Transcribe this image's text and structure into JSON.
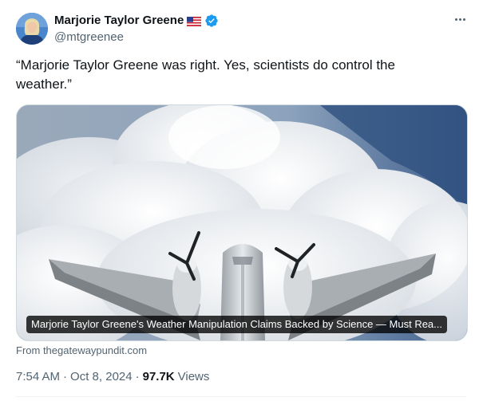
{
  "author": {
    "display_name": "Marjorie Taylor Greene",
    "handle": "@mtgreenee",
    "flag_icon": "us-flag-icon",
    "verified_icon": "verified-badge-icon",
    "verified_color": "#1d9bf0"
  },
  "tweet": {
    "text": "“Marjorie Taylor Greene was right. Yes, scientists do control the weather.”"
  },
  "card": {
    "title": "Marjorie Taylor Greene's Weather Manipulation Claims Backed by Science — Must Rea...",
    "source": "From thegatewaypundit.com"
  },
  "meta": {
    "time": "7:54 AM",
    "date": "Oct 8, 2024",
    "separator": "·",
    "views_count": "97.7K",
    "views_label": "Views"
  },
  "colors": {
    "text_primary": "#0f1419",
    "text_secondary": "#536471",
    "accent": "#1d9bf0"
  }
}
